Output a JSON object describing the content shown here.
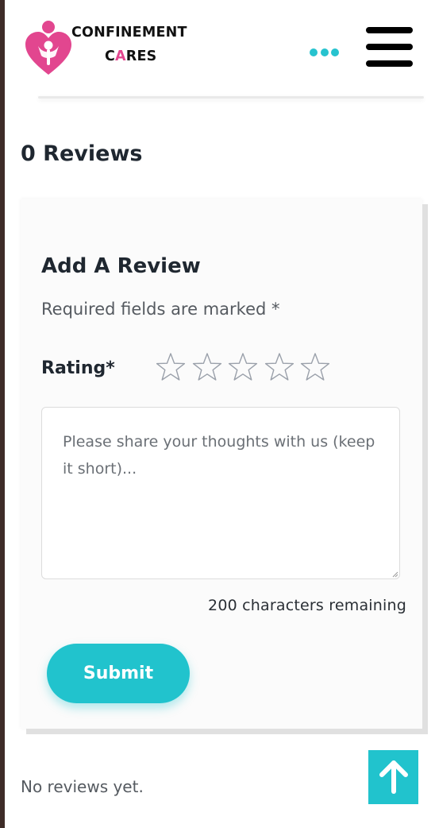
{
  "header": {
    "logo_line1": "CONFINEMENT",
    "logo_line2_a": "C",
    "logo_line2_b": "A",
    "logo_line2_c": "RES",
    "more_icon": "more-dots-icon",
    "menu_icon": "hamburger-menu-icon"
  },
  "reviews": {
    "title": "0 Reviews",
    "empty_text": "No reviews yet."
  },
  "review_form": {
    "title": "Add A Review",
    "required_note": "Required fields are marked *",
    "rating_label": "Rating*",
    "rating_value": 0,
    "rating_max": 5,
    "textarea_placeholder": "Please share your thoughts with us (keep it short)...",
    "char_remaining": "200 characters remaining",
    "submit_label": "Submit"
  },
  "colors": {
    "accent": "#21c3cd",
    "brand_pink": "#e2468f",
    "heading": "#1f2730"
  },
  "back_to_top_icon": "arrow-up-icon"
}
